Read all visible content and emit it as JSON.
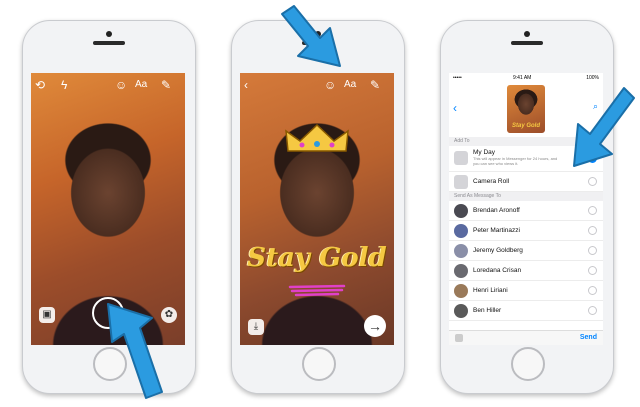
{
  "colors": {
    "accent": "#0084ff",
    "arrow": "#2b9be0",
    "gold": "#f5c842",
    "pink": "#e040c8"
  },
  "phone1": {
    "icons": [
      "camera-switch-icon",
      "flash-icon",
      "smiley-icon",
      "text-icon",
      "brush-icon",
      "gallery-icon",
      "shutter",
      "palette-icon"
    ],
    "text_icon_label": "Aa"
  },
  "phone2": {
    "text_icon_label": "Aa",
    "sticker_text": "Stay Gold",
    "icons": [
      "back-icon",
      "smiley-icon",
      "text-icon",
      "brush-icon",
      "download-icon",
      "send-arrow-icon"
    ]
  },
  "phone3": {
    "status": {
      "carrier": "•••••",
      "time": "9:41 AM",
      "battery": "100%"
    },
    "thumb_text": "Stay Gold",
    "add_to_header": "Add To",
    "add_to": [
      {
        "name": "My Day",
        "sub": "This will appear in Messenger for 24 hours, and you can see who views it.",
        "selected": true
      },
      {
        "name": "Camera Roll",
        "sub": "",
        "selected": false
      }
    ],
    "send_header": "Send As Message To",
    "contacts": [
      "Brendan Aronoff",
      "Peter Martinazzi",
      "Jeremy Goldberg",
      "Loredana Crisan",
      "Henri Liriani",
      "Ben Hiller"
    ],
    "send_label": "Send"
  }
}
